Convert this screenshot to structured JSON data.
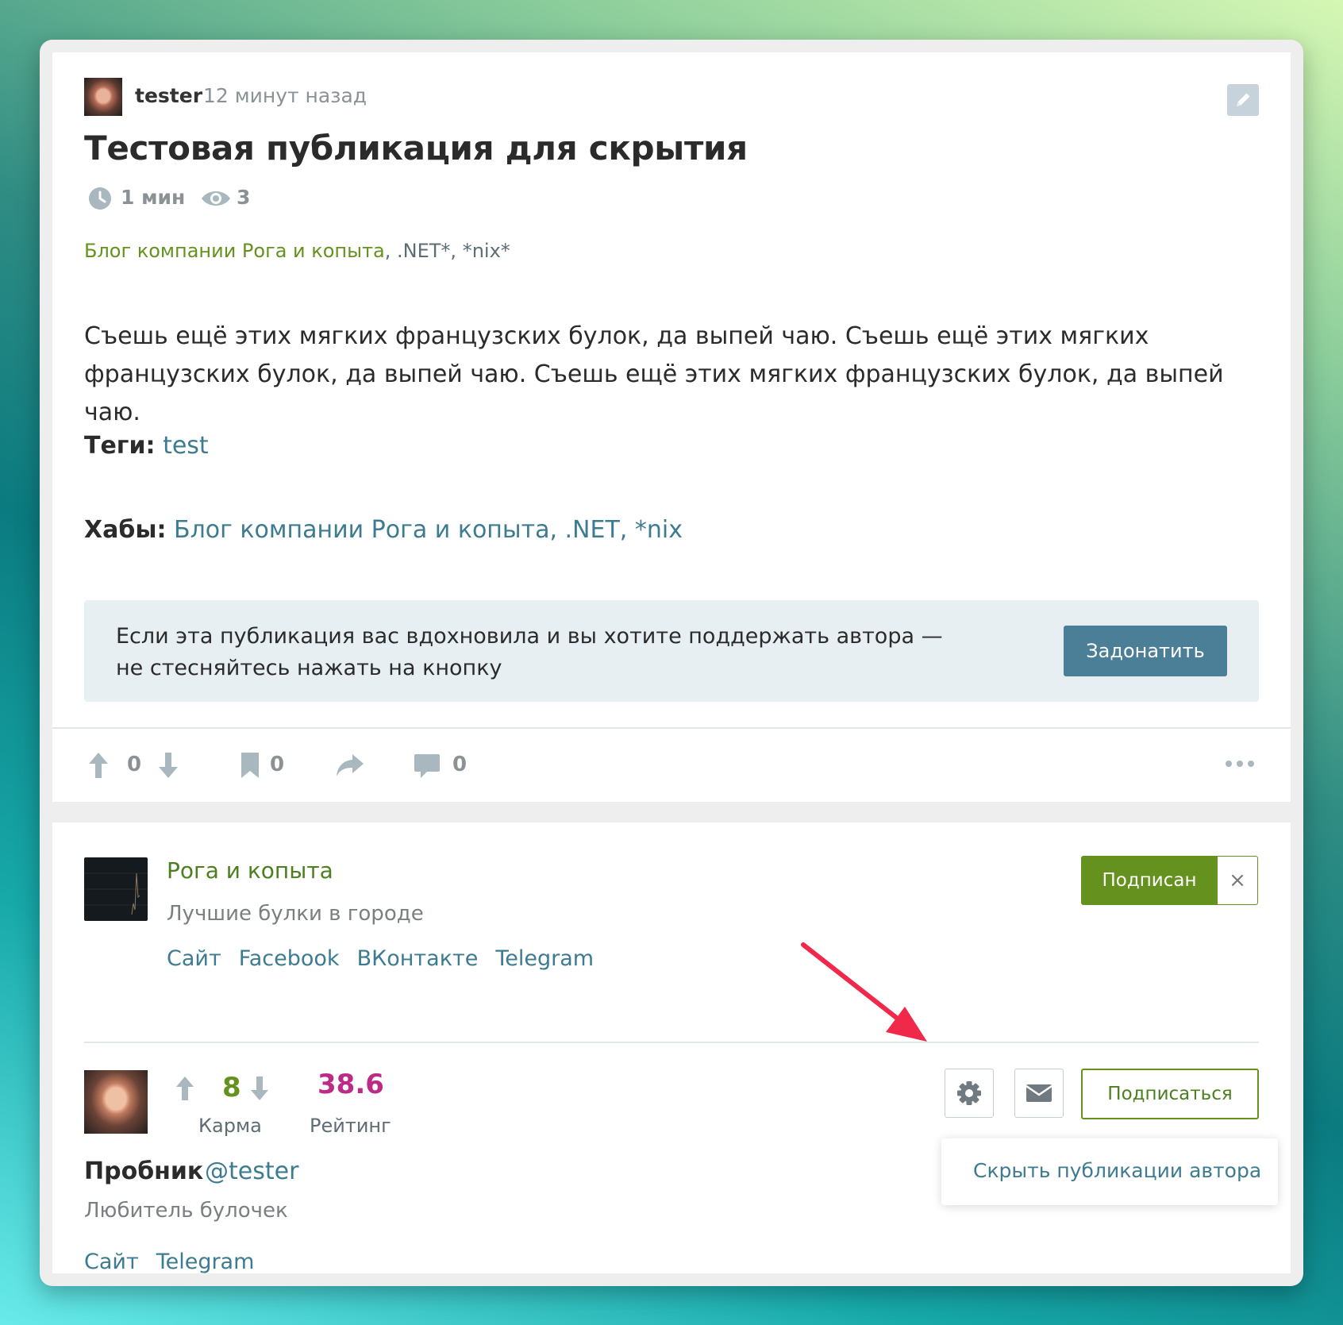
{
  "post": {
    "author": "tester",
    "time": "12 минут назад",
    "title": "Тестовая публикация для скрытия",
    "reading_time": "1 мин",
    "views": "3",
    "hub_primary": "Блог компании Рога и копыта",
    "hub_rest": ", .NET*, *nix*",
    "body": "Съешь ещё этих мягких французских булок, да выпей чаю. Съешь ещё этих мягких французских булок, да выпей чаю. Съешь ещё этих мягких французских булок, да выпей чаю.",
    "tags_label": "Теги:",
    "tags_value": "test",
    "hubs_label": "Хабы:",
    "hubs_value": "Блог компании Рога и копыта, .NET, *nix"
  },
  "donate": {
    "text_line1": "Если эта публикация вас вдохновила и вы хотите поддержать автора —",
    "text_line2": "не стесняйтесь нажать на кнопку",
    "button": "Задонатить"
  },
  "actions": {
    "votes": "0",
    "bookmarks": "0",
    "comments": "0"
  },
  "company": {
    "name": "Рога и копыта",
    "description": "Лучшие булки в городе",
    "links": [
      "Сайт",
      "Facebook",
      "ВКонтакте",
      "Telegram"
    ],
    "subscribed_label": "Подписан",
    "unsubscribe_x": "×"
  },
  "author": {
    "karma": "8",
    "karma_label": "Карма",
    "rating": "38.6",
    "rating_label": "Рейтинг",
    "subscribe_label": "Подписаться",
    "menu_item": "Скрыть публикации автора",
    "name": "Пробник",
    "nick": "@tester",
    "description": "Любитель булочек",
    "links": [
      "Сайт",
      "Telegram"
    ]
  },
  "colors": {
    "accent_green": "#65921e",
    "link_blue": "#3d7b91",
    "rating_magenta": "#bc2b86",
    "arrow_red": "#f0284a"
  }
}
